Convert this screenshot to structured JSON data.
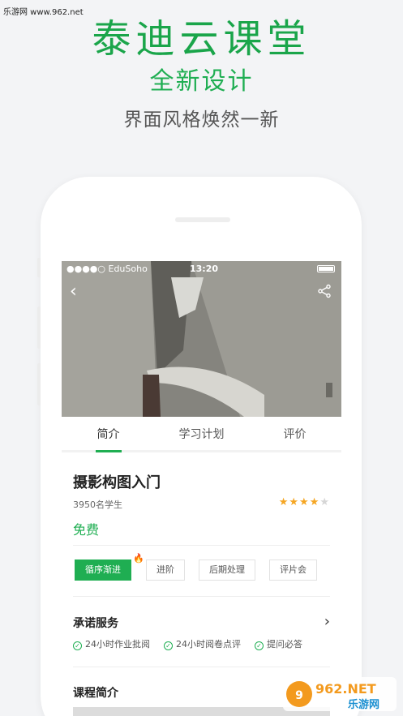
{
  "watermark_top": "乐游网 www.962.net",
  "hero": {
    "title": "泰迪云课堂",
    "subtitle": "全新设计",
    "tagline": "界面风格焕然一新"
  },
  "status_bar": {
    "carrier": "●●●●○ EduSoho",
    "time": "13:20"
  },
  "tabs": [
    {
      "label": "简介",
      "active": true
    },
    {
      "label": "学习计划",
      "active": false
    },
    {
      "label": "评价",
      "active": false
    }
  ],
  "course": {
    "title": "摄影构图入门",
    "students": "3950名学生",
    "rating": 4,
    "rating_max": 5,
    "price": "免费"
  },
  "chips": [
    {
      "label": "循序渐进",
      "active": true
    },
    {
      "label": "进阶",
      "active": false
    },
    {
      "label": "后期处理",
      "active": false
    },
    {
      "label": "评片会",
      "active": false
    }
  ],
  "service": {
    "title": "承诺服务",
    "promises": [
      "24小时作业批阅",
      "24小时阅卷点评",
      "提问必答"
    ]
  },
  "intro": {
    "title": "课程简介"
  },
  "logo": {
    "text_top": "962.NET",
    "text_bottom": "乐游网"
  },
  "colors": {
    "accent": "#1fae52",
    "star": "#f5a623"
  }
}
